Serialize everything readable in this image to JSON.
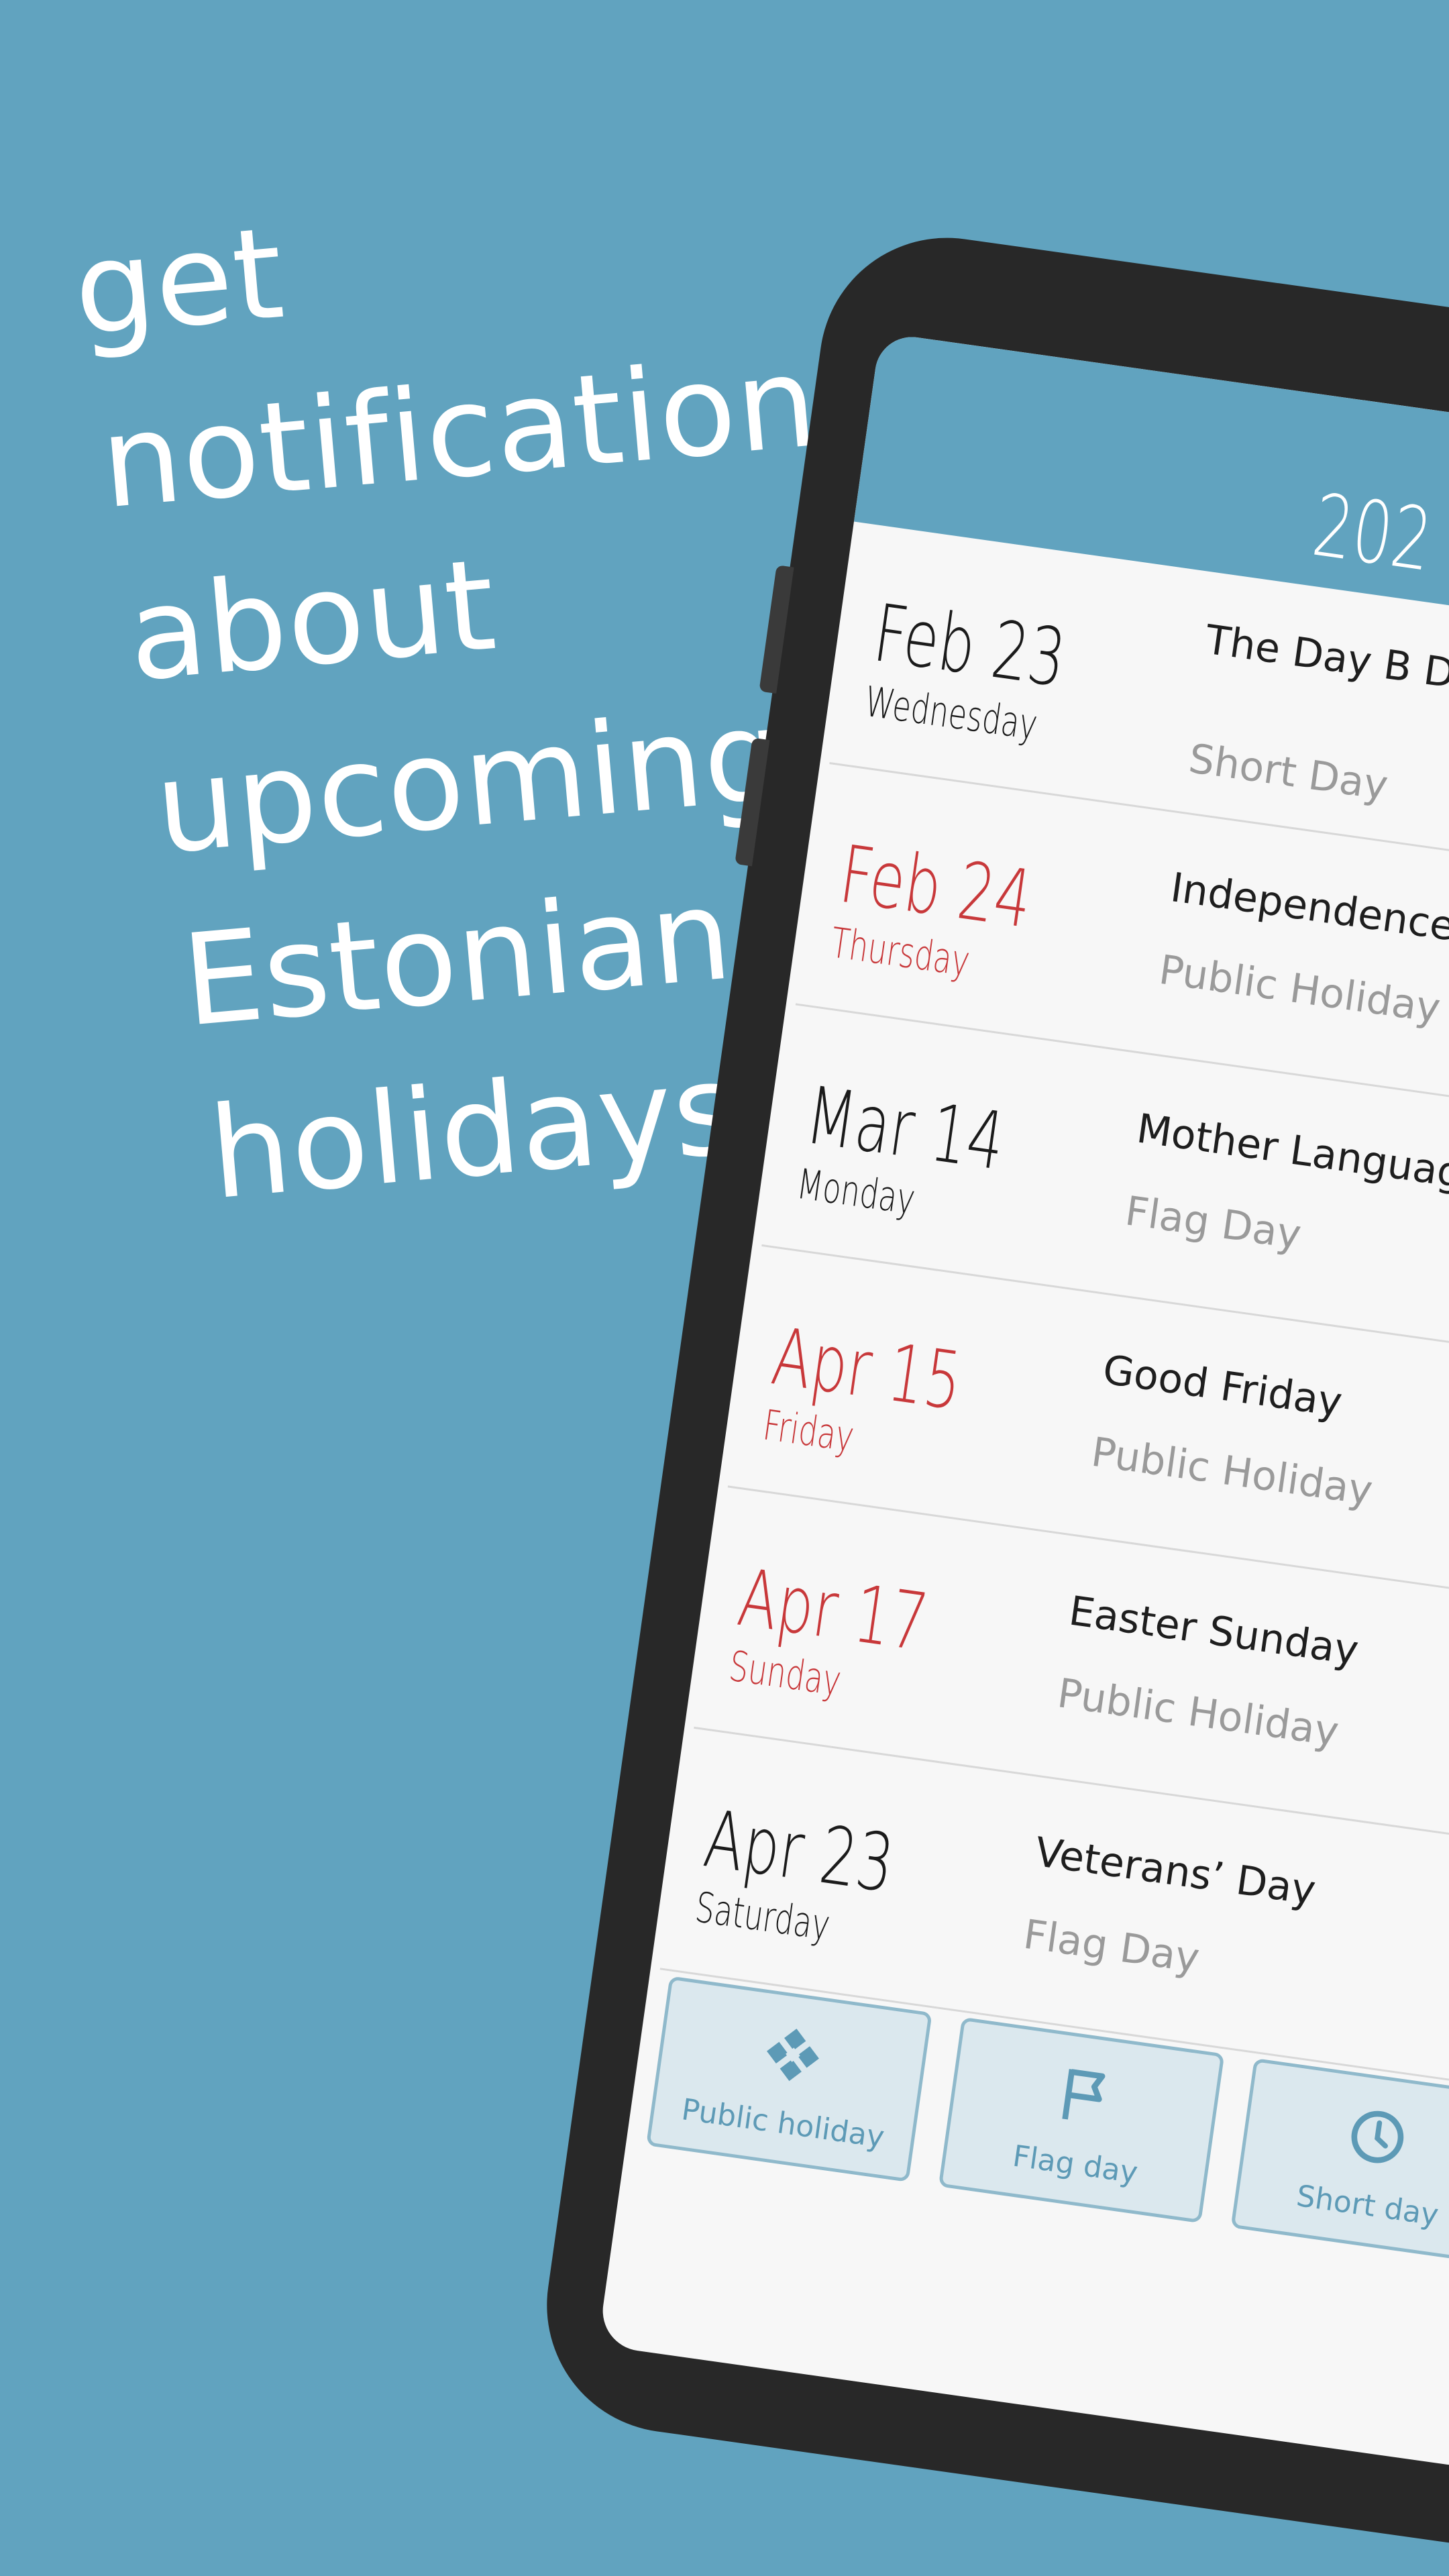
{
  "promo": {
    "lines": [
      "get",
      "notifications",
      "about",
      "upcoming",
      "Estonian",
      "holidays!"
    ]
  },
  "header": {
    "year": "202"
  },
  "holidays": [
    {
      "date": "Feb 23",
      "weekday": "Wednesday",
      "name": "The Day B Day",
      "type": "Short Day",
      "red": false
    },
    {
      "date": "Feb 24",
      "weekday": "Thursday",
      "name": "Independence",
      "type": "Public Holiday",
      "red": true
    },
    {
      "date": "Mar 14",
      "weekday": "Monday",
      "name": "Mother Languag",
      "type": "Flag Day",
      "red": false
    },
    {
      "date": "Apr 15",
      "weekday": "Friday",
      "name": "Good Friday",
      "type": "Public Holiday",
      "red": true
    },
    {
      "date": "Apr 17",
      "weekday": "Sunday",
      "name": "Easter Sunday",
      "type": "Public Holiday",
      "red": true
    },
    {
      "date": "Apr 23",
      "weekday": "Saturday",
      "name": "Veterans’ Day",
      "type": "Flag Day",
      "red": false
    }
  ],
  "filters": [
    {
      "label": "Public holiday",
      "icon": "public-holiday-icon"
    },
    {
      "label": "Flag day",
      "icon": "flag-icon"
    },
    {
      "label": "Short day",
      "icon": "clock-icon"
    }
  ],
  "colors": {
    "background": "#61a3bf",
    "holiday_red": "#c8383a",
    "accent": "#5d9ab6"
  }
}
